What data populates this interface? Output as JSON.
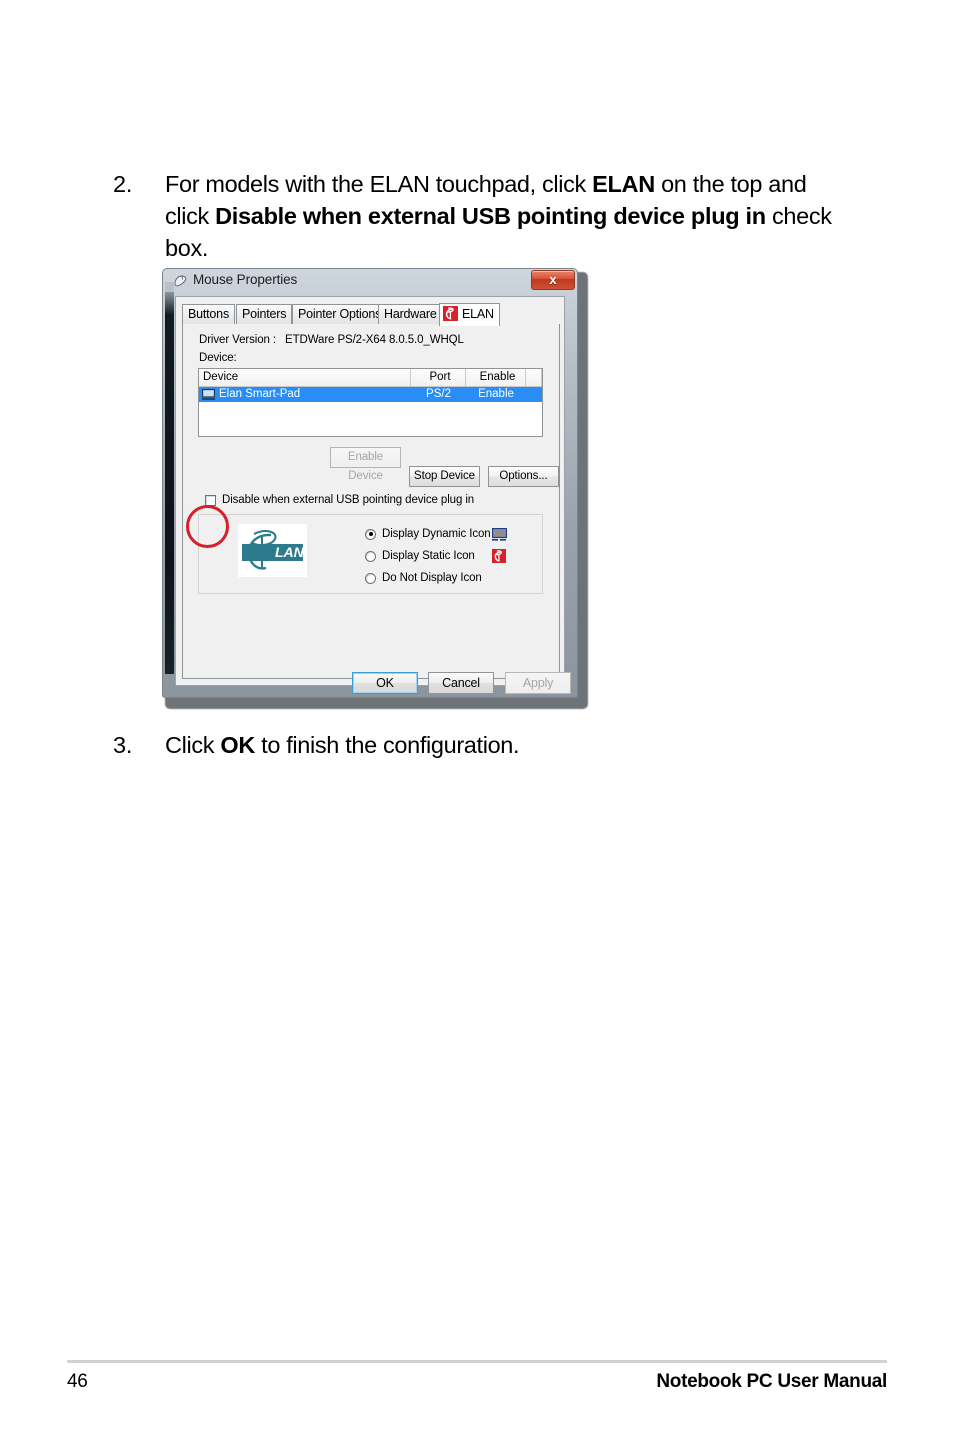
{
  "page": {
    "number": "46",
    "footer_title": "Notebook PC User Manual"
  },
  "steps": [
    {
      "number": "2.",
      "text_parts": [
        {
          "text": "For models with the ELAN touchpad, click ",
          "bold": false
        },
        {
          "text": "ELAN",
          "bold": true
        },
        {
          "text": " on the top and click ",
          "bold": false
        },
        {
          "text": "Disable when external USB pointing device plug in",
          "bold": true
        },
        {
          "text": " check box.",
          "bold": false
        }
      ]
    },
    {
      "number": "3.",
      "text_parts": [
        {
          "text": "Click ",
          "bold": false
        },
        {
          "text": "OK",
          "bold": true
        },
        {
          "text": " to finish the configuration.",
          "bold": false
        }
      ]
    }
  ],
  "dialog": {
    "title": "Mouse Properties",
    "title_icon": "mouse-icon",
    "close_label": "x",
    "tabs": [
      {
        "label": "Buttons",
        "active": false
      },
      {
        "label": "Pointers",
        "active": false
      },
      {
        "label": "Pointer Options",
        "active": false
      },
      {
        "label": "Hardware",
        "active": false
      },
      {
        "label": "ELAN",
        "active": true,
        "icon": "elan-logo-icon"
      }
    ],
    "driver": {
      "label": "Driver Version :",
      "value": "ETDWare PS/2-X64 8.0.5.0_WHQL"
    },
    "device_label": "Device:",
    "device_table": {
      "columns": [
        "Device",
        "Port",
        "Enable"
      ],
      "rows": [
        {
          "device": "Elan Smart-Pad",
          "port": "PS/2",
          "enable": "Enable",
          "selected": true,
          "icon": "touchpad-icon"
        }
      ]
    },
    "action_buttons": [
      {
        "label": "Enable Device",
        "disabled": true
      },
      {
        "label": "Stop Device",
        "disabled": false
      },
      {
        "label": "Options...",
        "disabled": false
      }
    ],
    "checkbox": {
      "label": "Disable when external USB pointing device plug in",
      "checked": false
    },
    "icon_group": {
      "logo_alt": "ELAN",
      "options": [
        {
          "label": "Display Dynamic Icon",
          "selected": true,
          "icon": "monitor-icon"
        },
        {
          "label": "Display Static Icon",
          "selected": false,
          "icon": "elan-red-icon"
        },
        {
          "label": "Do Not Display Icon",
          "selected": false,
          "icon": "none"
        }
      ]
    },
    "footer_buttons": [
      {
        "label": "OK",
        "default": true,
        "disabled": false
      },
      {
        "label": "Cancel",
        "default": false,
        "disabled": false
      },
      {
        "label": "Apply",
        "default": false,
        "disabled": true
      }
    ]
  },
  "annotation": {
    "shape": "circle",
    "color": "#d81e2a",
    "target": "disable-when-external-usb-checkbox"
  }
}
